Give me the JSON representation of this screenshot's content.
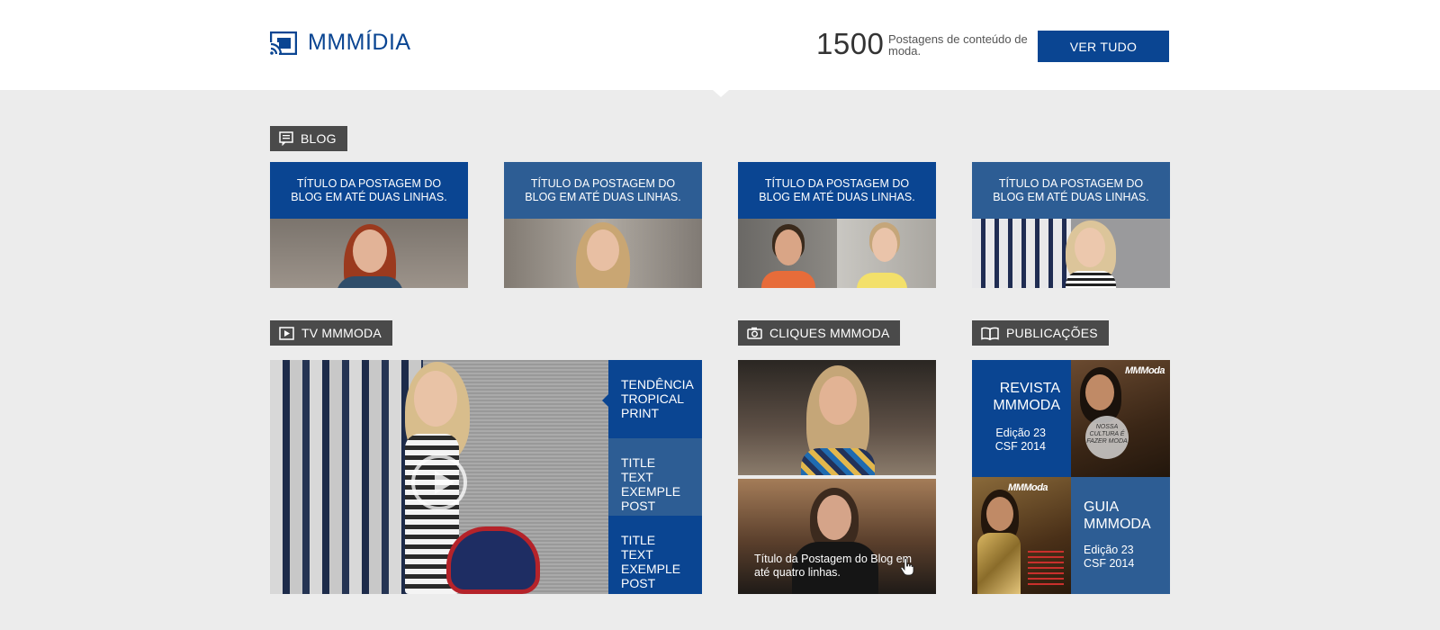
{
  "header": {
    "logo_text": "MMMÍDIA",
    "count": "1500",
    "count_desc": "Postagens de conteúdo de moda.",
    "button_label": "VER TUDO"
  },
  "blog": {
    "section_label": "BLOG",
    "posts": [
      {
        "title": "TÍTULO DA POSTAGEM DO BLOG EM ATÉ DUAS LINHAS."
      },
      {
        "title": "TÍTULO DA POSTAGEM DO BLOG EM ATÉ DUAS LINHAS."
      },
      {
        "title": "TÍTULO DA POSTAGEM DO BLOG EM ATÉ DUAS LINHAS."
      },
      {
        "title": "TÍTULO DA POSTAGEM DO BLOG EM ATÉ DUAS LINHAS."
      }
    ]
  },
  "tv": {
    "section_label": "TV MMMODA",
    "items": [
      {
        "title": "TENDÊNCIA TROPICAL PRINT"
      },
      {
        "title": "TITLE TEXT EXEMPLE POST"
      },
      {
        "title": "TITLE TEXT EXEMPLE POST"
      }
    ]
  },
  "cliques": {
    "section_label": "CLIQUES MMMODA",
    "caption": "Título da Postagem do Blog em até quatro linhas."
  },
  "publicacoes": {
    "section_label": "PUBLICAÇÕES",
    "items": [
      {
        "title": "REVISTA MMMODA",
        "edition": "Edição 23",
        "season": "CSF 2014"
      },
      {
        "title": "GUIA MMMODA",
        "edition": "Edição 23",
        "season": "CSF 2014"
      }
    ],
    "magazine_logo": "MMModa",
    "cover_text": "NOSSA CULTURA É FAZER MODA"
  },
  "colors": {
    "primary": "#0a4592",
    "secondary": "#2d5d94",
    "label_bg": "#4a4a4a",
    "page_bg": "#ececec"
  }
}
